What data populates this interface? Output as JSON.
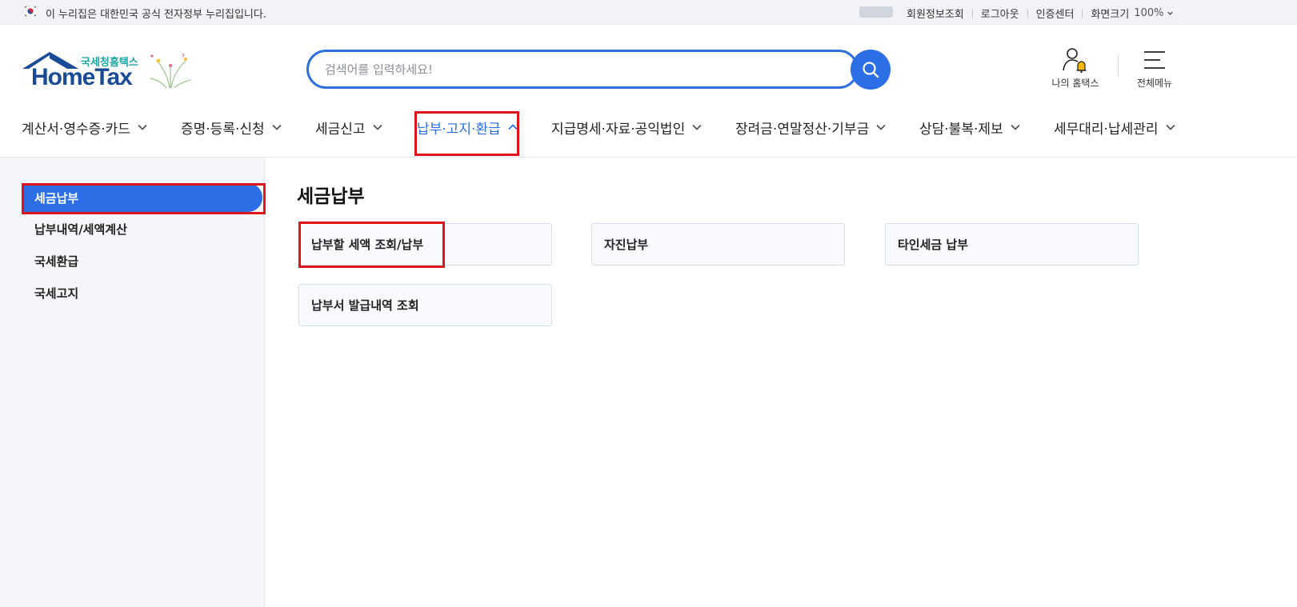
{
  "topbar": {
    "notice": "이 누리집은 대한민국 공식 전자정부 누리집입니다.",
    "links": [
      "회원정보조회",
      "로그아웃",
      "인증센터",
      "화면크기"
    ],
    "zoom": "100%",
    "icons": [
      "flag-icon",
      "chevron-down-icon"
    ]
  },
  "header": {
    "logo_sub": "국세청홈택스",
    "logo_main": "HomeTax",
    "search_placeholder": "검색어를 입력하세요!",
    "my_hometax": "나의 홈택스",
    "all_menu": "전체메뉴"
  },
  "gnb": {
    "items": [
      {
        "label": "계산서·영수증·카드",
        "active": false
      },
      {
        "label": "증명·등록·신청",
        "active": false
      },
      {
        "label": "세금신고",
        "active": false
      },
      {
        "label": "납부·고지·환급",
        "active": true
      },
      {
        "label": "지급명세·자료·공익법인",
        "active": false
      },
      {
        "label": "장려금·연말정산·기부금",
        "active": false
      },
      {
        "label": "상담·불복·제보",
        "active": false
      },
      {
        "label": "세무대리·납세관리",
        "active": false
      }
    ]
  },
  "sidebar": {
    "items": [
      {
        "label": "세금납부",
        "active": true
      },
      {
        "label": "납부내역/세액계산",
        "active": false
      },
      {
        "label": "국세환급",
        "active": false
      },
      {
        "label": "국세고지",
        "active": false
      }
    ]
  },
  "main": {
    "title": "세금납부",
    "cards": [
      {
        "label": "납부할 세액 조회/납부"
      },
      {
        "label": "자진납부"
      },
      {
        "label": "타인세금 납부"
      },
      {
        "label": "납부서 발급내역 조회"
      }
    ]
  },
  "colors": {
    "accent": "#2b6ee6",
    "highlight": "#e0141b",
    "logo_blue": "#1a4b97",
    "logo_teal": "#1fa4a0"
  }
}
